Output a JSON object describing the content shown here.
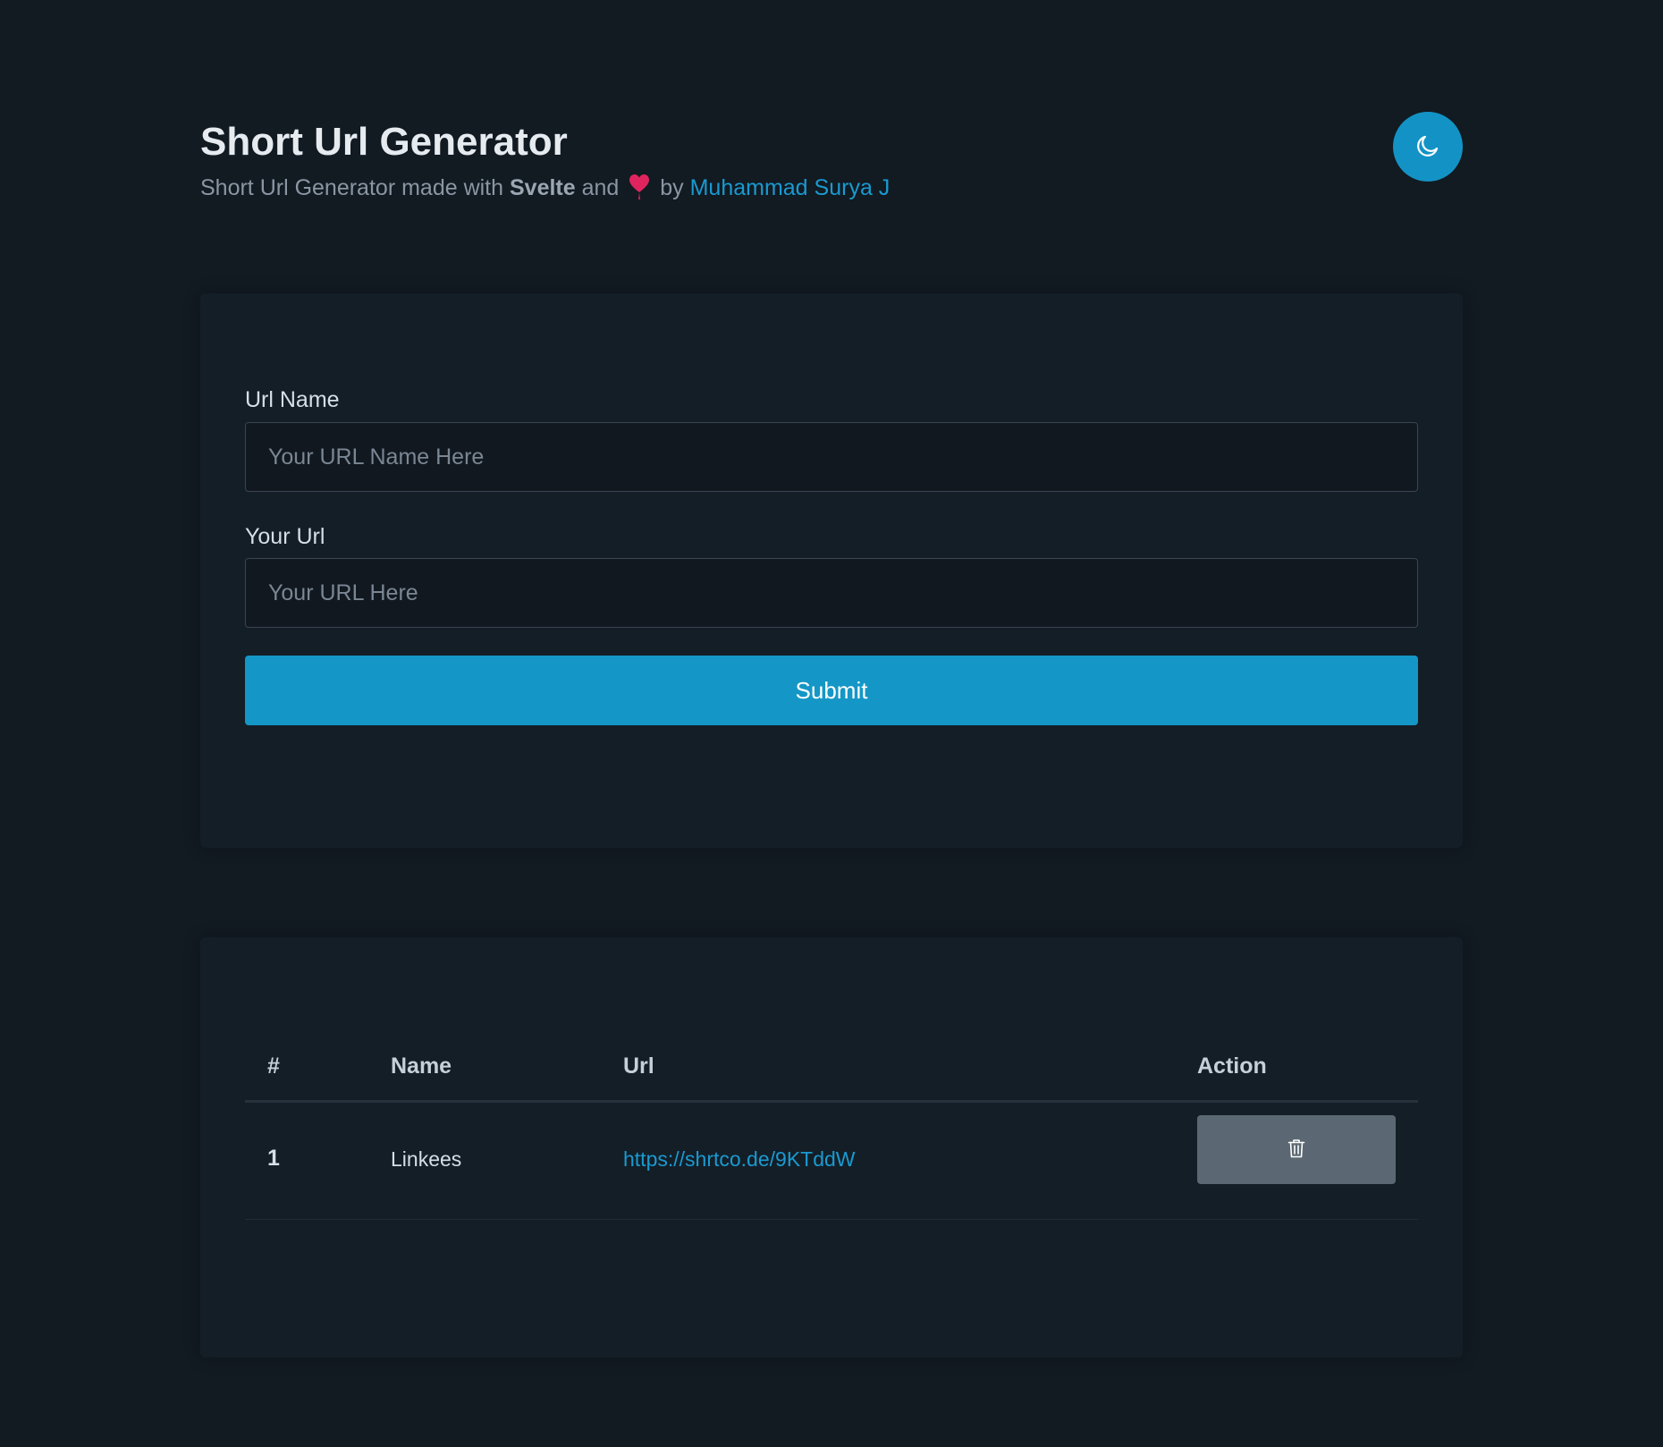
{
  "header": {
    "title": "Short Url Generator",
    "subtitle_prefix": "Short Url Generator made with",
    "framework": "Svelte",
    "subtitle_and": "and",
    "subtitle_by": "by",
    "author": "Muhammad Surya J",
    "heart_icon": "heart-icon",
    "theme_toggle_icon": "moon-icon"
  },
  "form": {
    "url_name_label": "Url Name",
    "url_name_placeholder": "Your URL Name Here",
    "url_name_value": "",
    "url_label": "Your Url",
    "url_placeholder": "Your URL Here",
    "url_value": "",
    "submit_label": "Submit"
  },
  "table": {
    "columns": [
      "#",
      "Name",
      "Url",
      "Action"
    ],
    "rows": [
      {
        "num": "1",
        "name": "Linkees",
        "url": "https://shrtco.de/9KTddW",
        "action_icon": "trash-icon"
      }
    ]
  },
  "colors": {
    "background": "#121a22",
    "card": "#141e27",
    "accent": "#1497c6",
    "link": "#1a9ad0",
    "heart": "#e0245e",
    "delete_button": "#5b6873"
  }
}
